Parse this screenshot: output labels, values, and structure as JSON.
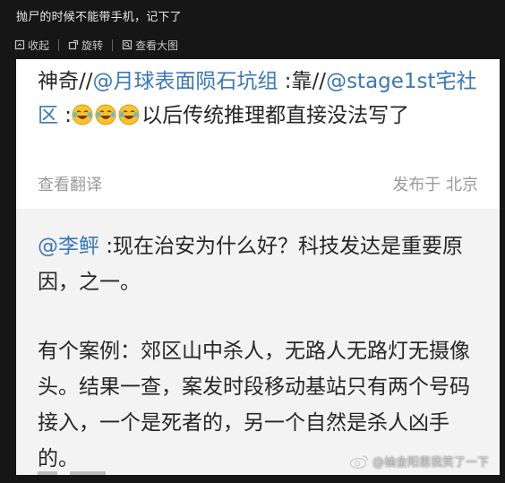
{
  "header": {
    "title": "抛尸的时候不能带手机，记下了"
  },
  "toolbar": {
    "collapse_label": "收起",
    "rotate_label": "旋转",
    "view_large_label": "查看大图"
  },
  "post": {
    "segments": [
      {
        "text": "神奇//",
        "mention": false
      },
      {
        "text": "@月球表面陨石坑组",
        "mention": true
      },
      {
        "text": " :靠//",
        "mention": false
      },
      {
        "text": "@stage1st宅社区",
        "mention": true
      },
      {
        "text": " :",
        "mention": false
      }
    ],
    "emoji_count": 3,
    "tail_text": "以后传统推理都直接没法写了",
    "translate_label": "查看翻译",
    "location_label": "发布于 北京"
  },
  "quote": {
    "mention": "@李鲆",
    "line1_rest": " :现在治安为什么好？科技发达是重要原因，之一。",
    "paragraph2": "有个案例：郊区山中杀人，无路人无路灯无摄像头。结果一查，案发时段移动基站只有两个号码接入，一个是死者的，另一个自然是杀人凶手的。"
  },
  "watermark": {
    "text": "@柚金阳惠我笑了一下"
  },
  "colors": {
    "mention": "#3a78b8",
    "background": "#161616"
  }
}
